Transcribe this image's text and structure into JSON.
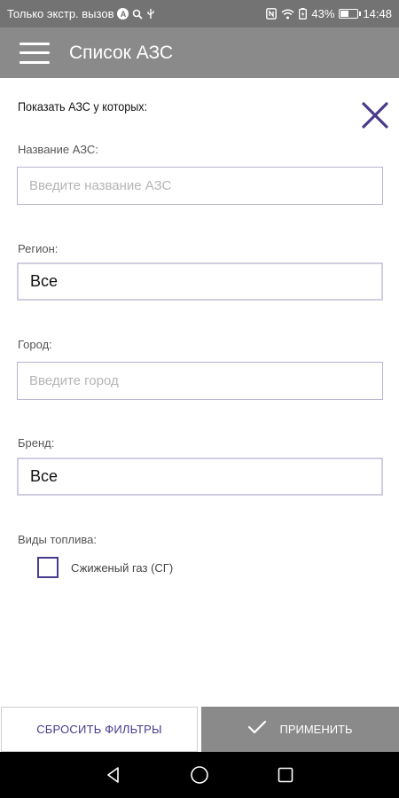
{
  "status_bar": {
    "carrier_text": "Только экстр. вызов",
    "icons": [
      "a-badge-icon",
      "search-icon",
      "usb-icon",
      "nfc-icon",
      "wifi-icon",
      "battery-saver-icon",
      "battery-icon"
    ],
    "a_badge": "A",
    "battery_percent": "43%",
    "battery_level": 0.43,
    "time": "14:48"
  },
  "app_bar": {
    "title": "Список АЗС",
    "menu_icon": "hamburger-menu-icon"
  },
  "filter": {
    "heading": "Показать АЗС у которых:",
    "close_icon": "close-icon",
    "station_name": {
      "label": "Название АЗС:",
      "placeholder": "Введите название АЗС",
      "value": ""
    },
    "region": {
      "label": "Регион:",
      "value": "Все"
    },
    "city": {
      "label": "Город:",
      "placeholder": "Введите город",
      "value": ""
    },
    "brand": {
      "label": "Бренд:",
      "value": "Все"
    },
    "fuel_types": {
      "label": "Виды топлива:",
      "options": [
        {
          "label": "Сжиженый газ (СГ)",
          "checked": false
        }
      ]
    }
  },
  "actions": {
    "reset_label": "СБРОСИТЬ ФИЛЬТРЫ",
    "apply_label": "ПРИМЕНИТЬ",
    "apply_icon": "check-icon"
  },
  "nav_bar": {
    "icons": [
      "back-icon",
      "home-icon",
      "recents-icon"
    ]
  },
  "colors": {
    "accent": "#4b3a8c",
    "app_bar": "#8a8a8a",
    "status_bar": "#737373",
    "nav_bar": "#000000"
  }
}
